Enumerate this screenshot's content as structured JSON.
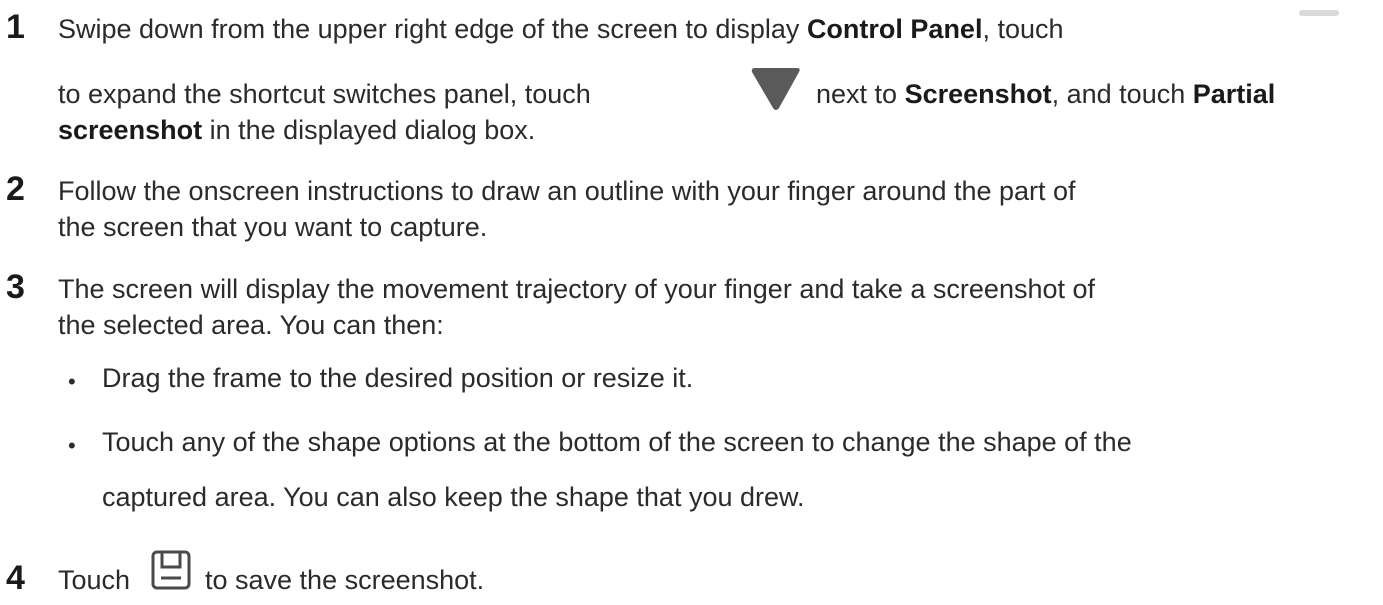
{
  "steps": [
    {
      "number": "1",
      "l1_a": "Swipe down from the upper right edge of the screen to display ",
      "l1_b": "Control Panel",
      "l1_c": ", touch",
      "l2_a": "to expand the shortcut switches panel, touch",
      "l2_b": "next to ",
      "l2_c": "Screenshot",
      "l2_d": ", and touch ",
      "l2_e": "Partial",
      "l3_a": "screenshot",
      "l3_b": " in the displayed dialog box."
    },
    {
      "number": "2",
      "l1": "Follow the onscreen instructions to draw an outline with your finger around the part of",
      "l2": "the screen that you want to capture."
    },
    {
      "number": "3",
      "l1": "The screen will display the movement trajectory of your finger and take a screenshot of",
      "l2": "the selected area. You can then:",
      "bullets": [
        {
          "l1": "Drag the frame to the desired position or resize it."
        },
        {
          "l1": "Touch any of the shape options at the bottom of the screen to change the shape of the",
          "l2": "captured area. You can also keep the shape that you drew."
        }
      ]
    },
    {
      "number": "4",
      "l1_a": "Touch",
      "l1_b": "to save the screenshot."
    }
  ],
  "icons": {
    "expand": "expand-handle-icon",
    "dropdown": "triangle-down-icon",
    "save": "save-icon"
  },
  "colors": {
    "text": "#2b2b2b",
    "icon_gray": "#d9d9d9",
    "icon_dark": "#5a5a5a"
  }
}
